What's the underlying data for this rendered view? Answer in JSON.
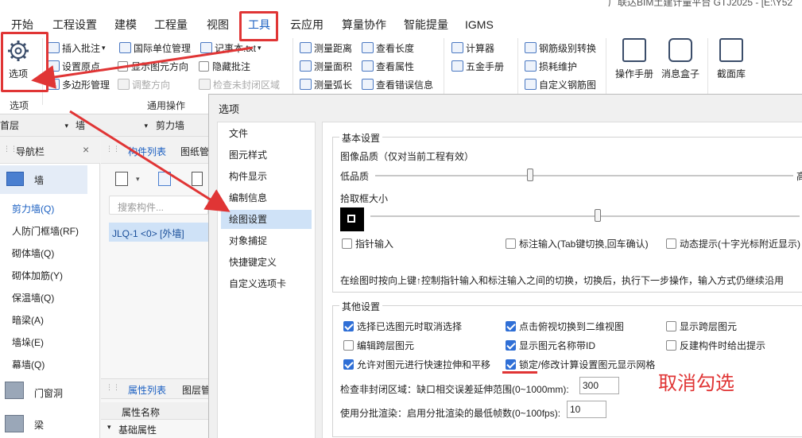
{
  "window": {
    "title": "广联达BIM土建计量平台 GTJ2025 - [E:\\Y52"
  },
  "menu_tabs": [
    "开始",
    "工程设置",
    "建模",
    "工程量",
    "视图",
    "工具",
    "云应用",
    "算量协作",
    "智能提量",
    "IGMS"
  ],
  "active_tab": "工具",
  "ribbon": {
    "options_label": "选项",
    "group_options": "选项",
    "group_common": "通用操作",
    "buttons": {
      "insert_note": "插入批注",
      "unit_manage": "国际单位管理",
      "notepad": "记事本.txt",
      "set_origin": "设置原点",
      "show_elem_dir": "显示图元方向",
      "hide_note": "隐藏批注",
      "polygon_manage": "多边形管理",
      "adjust_dir": "调整方向",
      "check_unclosed": "检查未封闭区域",
      "measure_dist": "测量距离",
      "view_length": "查看长度",
      "measure_area": "测量面积",
      "view_attr": "查看属性",
      "measure_arc": "测量弧长",
      "view_error": "查看错误信息",
      "calculator": "计算器",
      "hardware_manual": "五金手册",
      "rebar_convert": "钢筋级别转换",
      "loss_maintain": "损耗维护",
      "custom_rebar": "自定义钢筋图",
      "op_manual": "操作手册",
      "msg_box": "消息盒子",
      "section_lib": "截面库"
    }
  },
  "floorbar": {
    "floor": "首层",
    "type": "墙",
    "sub": "剪力墙"
  },
  "nav": {
    "title": "导航栏",
    "wall": "墙",
    "items": [
      "剪力墙(Q)",
      "人防门框墙(RF)",
      "砌体墙(Q)",
      "砌体加筋(Y)",
      "保温墙(Q)",
      "暗梁(A)",
      "墙垛(E)",
      "幕墙(Q)"
    ],
    "door": "门窗洞",
    "beam": "梁"
  },
  "mid": {
    "tab1": "构件列表",
    "tab2": "图纸管",
    "search_placeholder": "搜索构件...",
    "component": "JLQ-1 <0> [外墙]",
    "attr_tab1": "属性列表",
    "attr_tab2": "图层管",
    "attr_header": "属性名称",
    "attr_basic": "基础属性"
  },
  "dialog": {
    "title": "选项",
    "list": [
      "文件",
      "图元样式",
      "构件显示",
      "编制信息",
      "绘图设置",
      "对象捕捉",
      "快捷键定义",
      "自定义选项卡"
    ],
    "selected": "绘图设置",
    "basic_legend": "基本设置",
    "image_quality": "图像品质（仅对当前工程有效）",
    "low_quality": "低品质",
    "high_quality": "高",
    "pick_size": "拾取框大小",
    "image_quality_level": 0.37,
    "pick_size_level": 0.53,
    "pointer_input": "指针输入",
    "label_input": "标注输入(Tab键切换,回车确认)",
    "dynamic_hint": "动态提示(十字光标附近显示)",
    "drawing_note": "在绘图时按向上键↑控制指针输入和标注输入之间的切换，切换后，执行下一步操作，输入方式仍继续沿用",
    "other_legend": "其他设置",
    "checks": [
      {
        "label": "选择已选图元时取消选择",
        "checked": true
      },
      {
        "label": "点击俯视切换到二维视图",
        "checked": true
      },
      {
        "label": "显示跨层图元",
        "checked": false
      },
      {
        "label": "编辑跨层图元",
        "checked": false
      },
      {
        "label": "显示图元名称带ID",
        "checked": true
      },
      {
        "label": "反建构件时给出提示",
        "checked": false
      },
      {
        "label": "允许对图元进行快速拉伸和平移",
        "checked": true
      },
      {
        "label": "锁定/修改计算设置图元显示网格",
        "checked": true
      }
    ],
    "check_unclosed_label": "检查非封闭区域：缺口相交误差延伸范围(0~1000mm):",
    "check_unclosed_value": "300",
    "batch_render_label": "使用分批渲染：启用分批渲染的最低帧数(0~100fps):",
    "batch_render_value": "10"
  },
  "annotation": {
    "text": "取消勾选",
    "color": "#e03535"
  }
}
